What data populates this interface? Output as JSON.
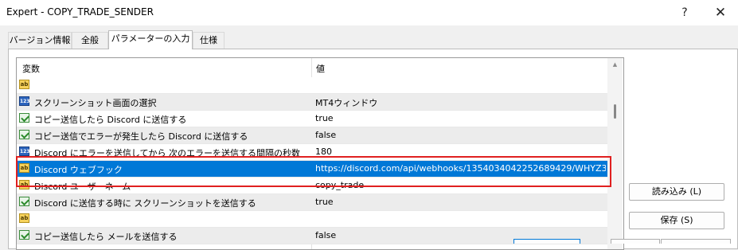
{
  "window": {
    "title": "Expert - COPY_TRADE_SENDER",
    "help_label": "?",
    "close_label": "✕"
  },
  "tabs": [
    {
      "label": "バージョン情報"
    },
    {
      "label": "全般"
    },
    {
      "label": "パラメーターの入力",
      "active": true
    },
    {
      "label": "仕様"
    }
  ],
  "table": {
    "headers": {
      "name": "変数",
      "value": "値"
    },
    "rows": [
      {
        "icon": "ab-icon",
        "icon_text": "ab",
        "name": "",
        "value": ""
      },
      {
        "icon": "123-icon",
        "icon_text": "123",
        "name": "スクリーンショット画面の選択",
        "value": "MT4ウィンドウ"
      },
      {
        "icon": "bool-icon",
        "name": "コピー送信したら Discord に送信する",
        "value": "true"
      },
      {
        "icon": "bool-icon",
        "name": "コピー送信でエラーが発生したら Discord に送信する",
        "value": "false"
      },
      {
        "icon": "123-icon",
        "icon_text": "123",
        "name": "Discord にエラーを送信してから 次のエラーを送信する間隔の秒数",
        "value": "180"
      },
      {
        "icon": "ab-icon",
        "icon_text": "ab",
        "name": "Discord ウェブフック",
        "value": "https://discord.com/api/webhooks/1354034042252689429/WHYZ3...",
        "selected": true
      },
      {
        "icon": "ab-icon",
        "icon_text": "ab",
        "name": "Discord ユーザーネーム",
        "value": "copy_trade"
      },
      {
        "icon": "bool-icon",
        "name": "Discord に送信する時に スクリーンショットを送信する",
        "value": "true"
      },
      {
        "icon": "ab-icon",
        "icon_text": "ab",
        "name": "",
        "value": ""
      },
      {
        "icon": "bool-icon",
        "name": "コピー送信したら メールを送信する",
        "value": "false"
      }
    ]
  },
  "buttons": {
    "load": "読み込み (L)",
    "save": "保存 (S)"
  },
  "colors": {
    "selection": "#0078d7",
    "highlight_border": "#e02020"
  }
}
